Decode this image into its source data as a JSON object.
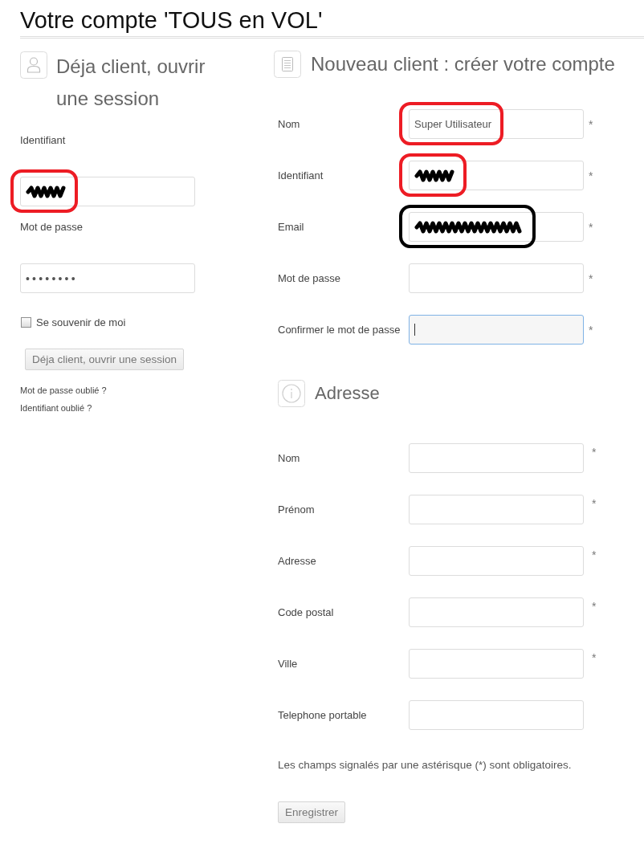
{
  "page": {
    "title": "Votre compte 'TOUS en VOL'"
  },
  "login": {
    "heading": "Déja client, ouvrir une session",
    "fields": [
      {
        "label": "Identifiant",
        "kind": "text",
        "redacted": true,
        "annotation_ring": {
          "color": "#ed1c24"
        }
      },
      {
        "label": "Mot de passe",
        "kind": "password",
        "value": "••••••••",
        "redacted": false
      }
    ],
    "remember": {
      "label": "Se souvenir de moi",
      "checked": false
    },
    "submit": "Déja client, ouvrir une session",
    "links": [
      "Mot de passe oublié ?",
      "Identifiant oublié ?"
    ]
  },
  "register": {
    "heading": "Nouveau client : créer votre compte",
    "fields": [
      {
        "label": "Nom",
        "kind": "text",
        "value": "Super Utilisateur",
        "required_mark": "*",
        "redacted": false,
        "annotation_ring": {
          "color": "#ed1c24"
        },
        "focused": false
      },
      {
        "label": "Identifiant",
        "kind": "text",
        "required_mark": "*",
        "redacted": true,
        "annotation_ring": {
          "color": "#ed1c24"
        },
        "focused": false
      },
      {
        "label": "Email",
        "kind": "email",
        "required_mark": "*",
        "redacted": true,
        "annotation_ring": {
          "color": "#000000"
        },
        "focused": false
      },
      {
        "label": "Mot de passe",
        "kind": "password",
        "required_mark": "*",
        "redacted": false,
        "focused": false
      },
      {
        "label": "Confirmer le mot de passe",
        "kind": "password",
        "required_mark": "*",
        "redacted": false,
        "focused": true
      }
    ]
  },
  "address": {
    "heading": "Adresse",
    "fields": [
      {
        "label": "Nom",
        "kind": "text",
        "required_mark": "*"
      },
      {
        "label": "Prénom",
        "kind": "text",
        "required_mark": "*"
      },
      {
        "label": "Adresse",
        "kind": "text",
        "required_mark": "*"
      },
      {
        "label": "Code postal",
        "kind": "text",
        "required_mark": "*"
      },
      {
        "label": "Ville",
        "kind": "text",
        "required_mark": "*"
      },
      {
        "label": "Telephone portable",
        "kind": "text"
      }
    ]
  },
  "note": "Les champs signalés par une astérisque (*) sont obligatoires.",
  "submit": "Enregistrer"
}
